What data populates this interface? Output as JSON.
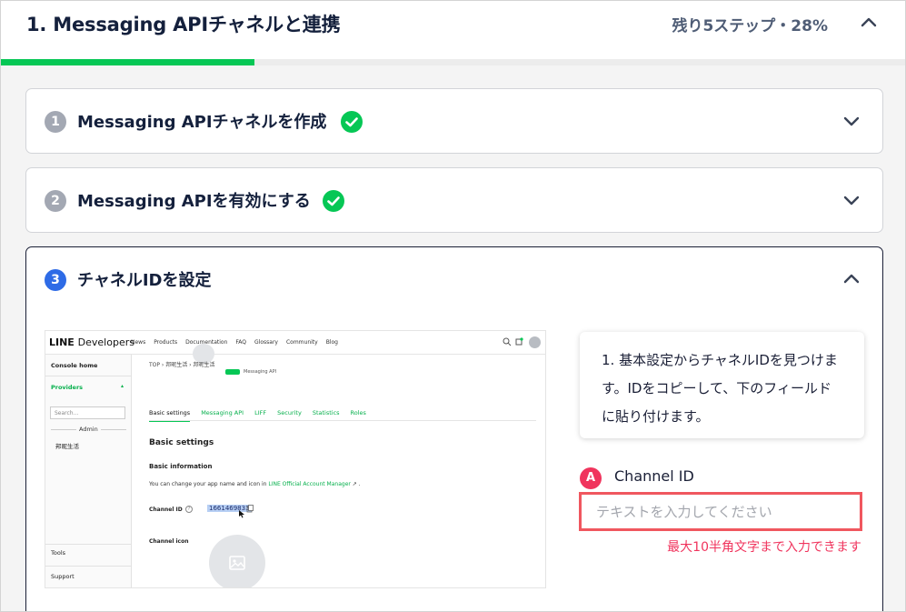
{
  "header": {
    "title": "1. Messaging APIチャネルと連携",
    "progress_text": "残り5ステップ・28%",
    "progress_percent": 28
  },
  "steps": [
    {
      "number": "1",
      "title": "Messaging APIチャネルを作成",
      "status": "complete"
    },
    {
      "number": "2",
      "title": "Messaging APIを有効にする",
      "status": "complete"
    },
    {
      "number": "3",
      "title": "チャネルIDを設定",
      "status": "active"
    }
  ],
  "screenshot": {
    "logo_bold": "LINE",
    "logo_light": "Developers",
    "menu": [
      "News",
      "Products",
      "Documentation",
      "FAQ",
      "Glossary",
      "Community",
      "Blog"
    ],
    "sidebar": {
      "console_home": "Console home",
      "providers": "Providers",
      "search_placeholder": "Search...",
      "admin": "Admin",
      "provider_name": "邦昵生活",
      "tools": "Tools",
      "support": "Support"
    },
    "breadcrumb": "TOP  ›  邦昵生活  ›  邦昵生活",
    "badge_small": "Messaging API",
    "tabs": [
      "Basic settings",
      "Messaging API",
      "LIFF",
      "Security",
      "Statistics",
      "Roles"
    ],
    "section_title": "Basic settings",
    "subsection_title": "Basic information",
    "info_text_prefix": "You can change your app name and icon in ",
    "info_link": "LINE Official Account Manager",
    "channel_id_label": "Channel ID",
    "channel_id_value": "1661469833",
    "channel_icon_label": "Channel icon"
  },
  "instruction": "1. 基本設定からチャネルIDを見つけます。IDをコピーして、下のフィールドに貼り付けます。",
  "field": {
    "badge": "A",
    "label": "Channel ID",
    "placeholder": "テキストを入力してください",
    "value": "",
    "hint": "最大10半角文字まで入力できます"
  },
  "colors": {
    "progress": "#06c755",
    "check": "#06c755",
    "active_step": "#2e6be6",
    "error": "#f0345d"
  }
}
